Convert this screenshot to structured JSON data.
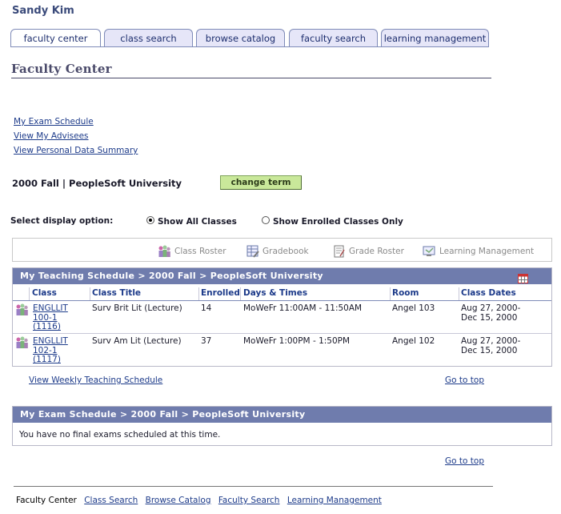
{
  "user": {
    "name": "Sandy Kim"
  },
  "tabs": [
    {
      "label": "faculty center",
      "active": true
    },
    {
      "label": "class search"
    },
    {
      "label": "browse catalog"
    },
    {
      "label": "faculty search"
    },
    {
      "label": "learning management"
    }
  ],
  "page_title": "Faculty Center",
  "top_links": [
    "My Exam Schedule",
    "View My Advisees",
    "View Personal Data Summary"
  ],
  "term": {
    "label": "2000 Fall | PeopleSoft University",
    "button": "change term"
  },
  "display": {
    "label": "Select display option:",
    "options": [
      {
        "label": "Show All Classes",
        "selected": true
      },
      {
        "label": "Show Enrolled Classes Only",
        "selected": false
      }
    ]
  },
  "toolbar": {
    "class_roster": "Class Roster",
    "gradebook": "Gradebook",
    "grade_roster": "Grade Roster",
    "learning_management": "Learning Management"
  },
  "schedule": {
    "title": "My Teaching Schedule > 2000 Fall > PeopleSoft University",
    "columns": [
      "Class",
      "Class Title",
      "Enrolled",
      "Days & Times",
      "Room",
      "Class Dates"
    ],
    "rows": [
      {
        "class_lines": [
          "ENGLLIT",
          "100-1",
          "(1116)"
        ],
        "title": "Surv Brit Lit (Lecture)",
        "enrolled": "14",
        "days_times": "MoWeFr 11:00AM - 11:50AM",
        "room": "Angel 103",
        "dates_lines": [
          "Aug 27, 2000-",
          "Dec 15, 2000"
        ]
      },
      {
        "class_lines": [
          "ENGLLIT",
          "102-1",
          "(1117)"
        ],
        "title": "Surv Am Lit (Lecture)",
        "enrolled": "37",
        "days_times": "MoWeFr 1:00PM - 1:50PM",
        "room": "Angel 102",
        "dates_lines": [
          "Aug 27, 2000-",
          "Dec 15, 2000"
        ]
      }
    ],
    "weekly_link": "View Weekly Teaching Schedule",
    "go_to_top": "Go to top"
  },
  "exam": {
    "title": "My Exam Schedule > 2000 Fall > PeopleSoft University",
    "message": "You have no final exams scheduled at this time.",
    "go_to_top": "Go to top"
  },
  "footer": {
    "current": "Faculty Center",
    "links": [
      "Class Search",
      "Browse Catalog",
      "Faculty Search",
      "Learning Management"
    ]
  },
  "icons": {
    "roster": "people-icon",
    "gradebook": "gradebook-icon",
    "grade_roster": "grade-roster-icon",
    "learning": "learning-icon",
    "grid": "grid-icon"
  },
  "colors": {
    "header_band": "#6f7cad",
    "link": "#1d3b8a",
    "button": "#c9e89a"
  }
}
